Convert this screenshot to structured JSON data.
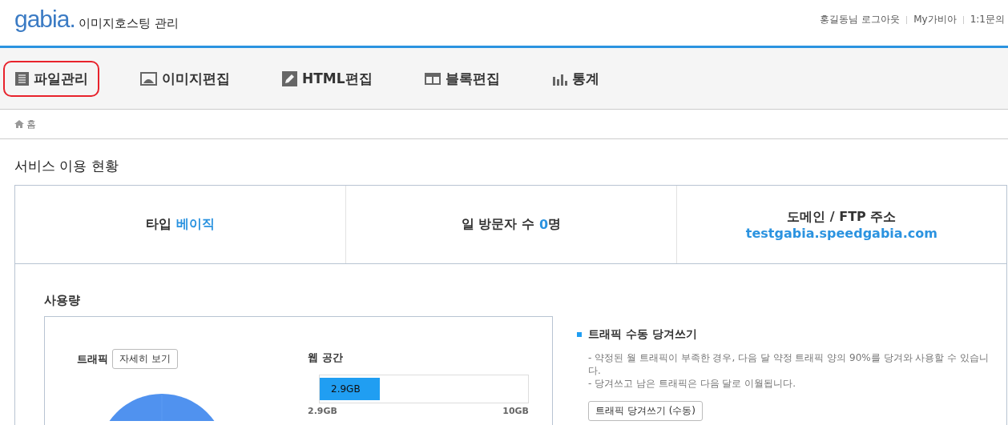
{
  "header": {
    "logo": "gabia.",
    "service_title": "이미지호스팅 관리",
    "user_links": [
      "홍길동님 로그아웃",
      "My가비아",
      "1:1문의"
    ]
  },
  "nav": [
    {
      "label": "파일관리",
      "kind": "list",
      "selected": true
    },
    {
      "label": "이미지편집",
      "kind": "image",
      "selected": false
    },
    {
      "label": "HTML편집",
      "kind": "pencil",
      "selected": false
    },
    {
      "label": "블록편집",
      "kind": "blocks",
      "selected": false
    },
    {
      "label": "통계",
      "kind": "bars",
      "selected": false
    }
  ],
  "breadcrumb": "홈",
  "page_title": "서비스 이용 현황",
  "summary": [
    {
      "kind": "inline",
      "label": "타입",
      "value": "베이직"
    },
    {
      "kind": "inline",
      "label": "일 방문자 수",
      "value": "0",
      "suffix": "명"
    },
    {
      "kind": "stacked",
      "label": "도메인 / FTP 주소",
      "value": "testgabia.speedgabia.com"
    }
  ],
  "usage": {
    "title": "사용량",
    "traffic": {
      "label": "트래픽",
      "button": "자세히 보기"
    },
    "web_space": {
      "label": "웹 공간",
      "bar_text": "2.9GB",
      "level": 0.29,
      "min_label": "2.9GB",
      "max_label": "10GB"
    },
    "pull": {
      "title": "트래픽 수동 당겨쓰기",
      "lines": [
        "- 약정된 월 트래픽이 부족한 경우, 다음 달 약정 트래픽 양의 90%를 당겨와 사용할 수 있습니다.",
        "- 당겨쓰고 남은 트래픽은 다음 달로 이월됩니다."
      ],
      "button": "트래픽 당겨쓰기 (수동)"
    }
  }
}
